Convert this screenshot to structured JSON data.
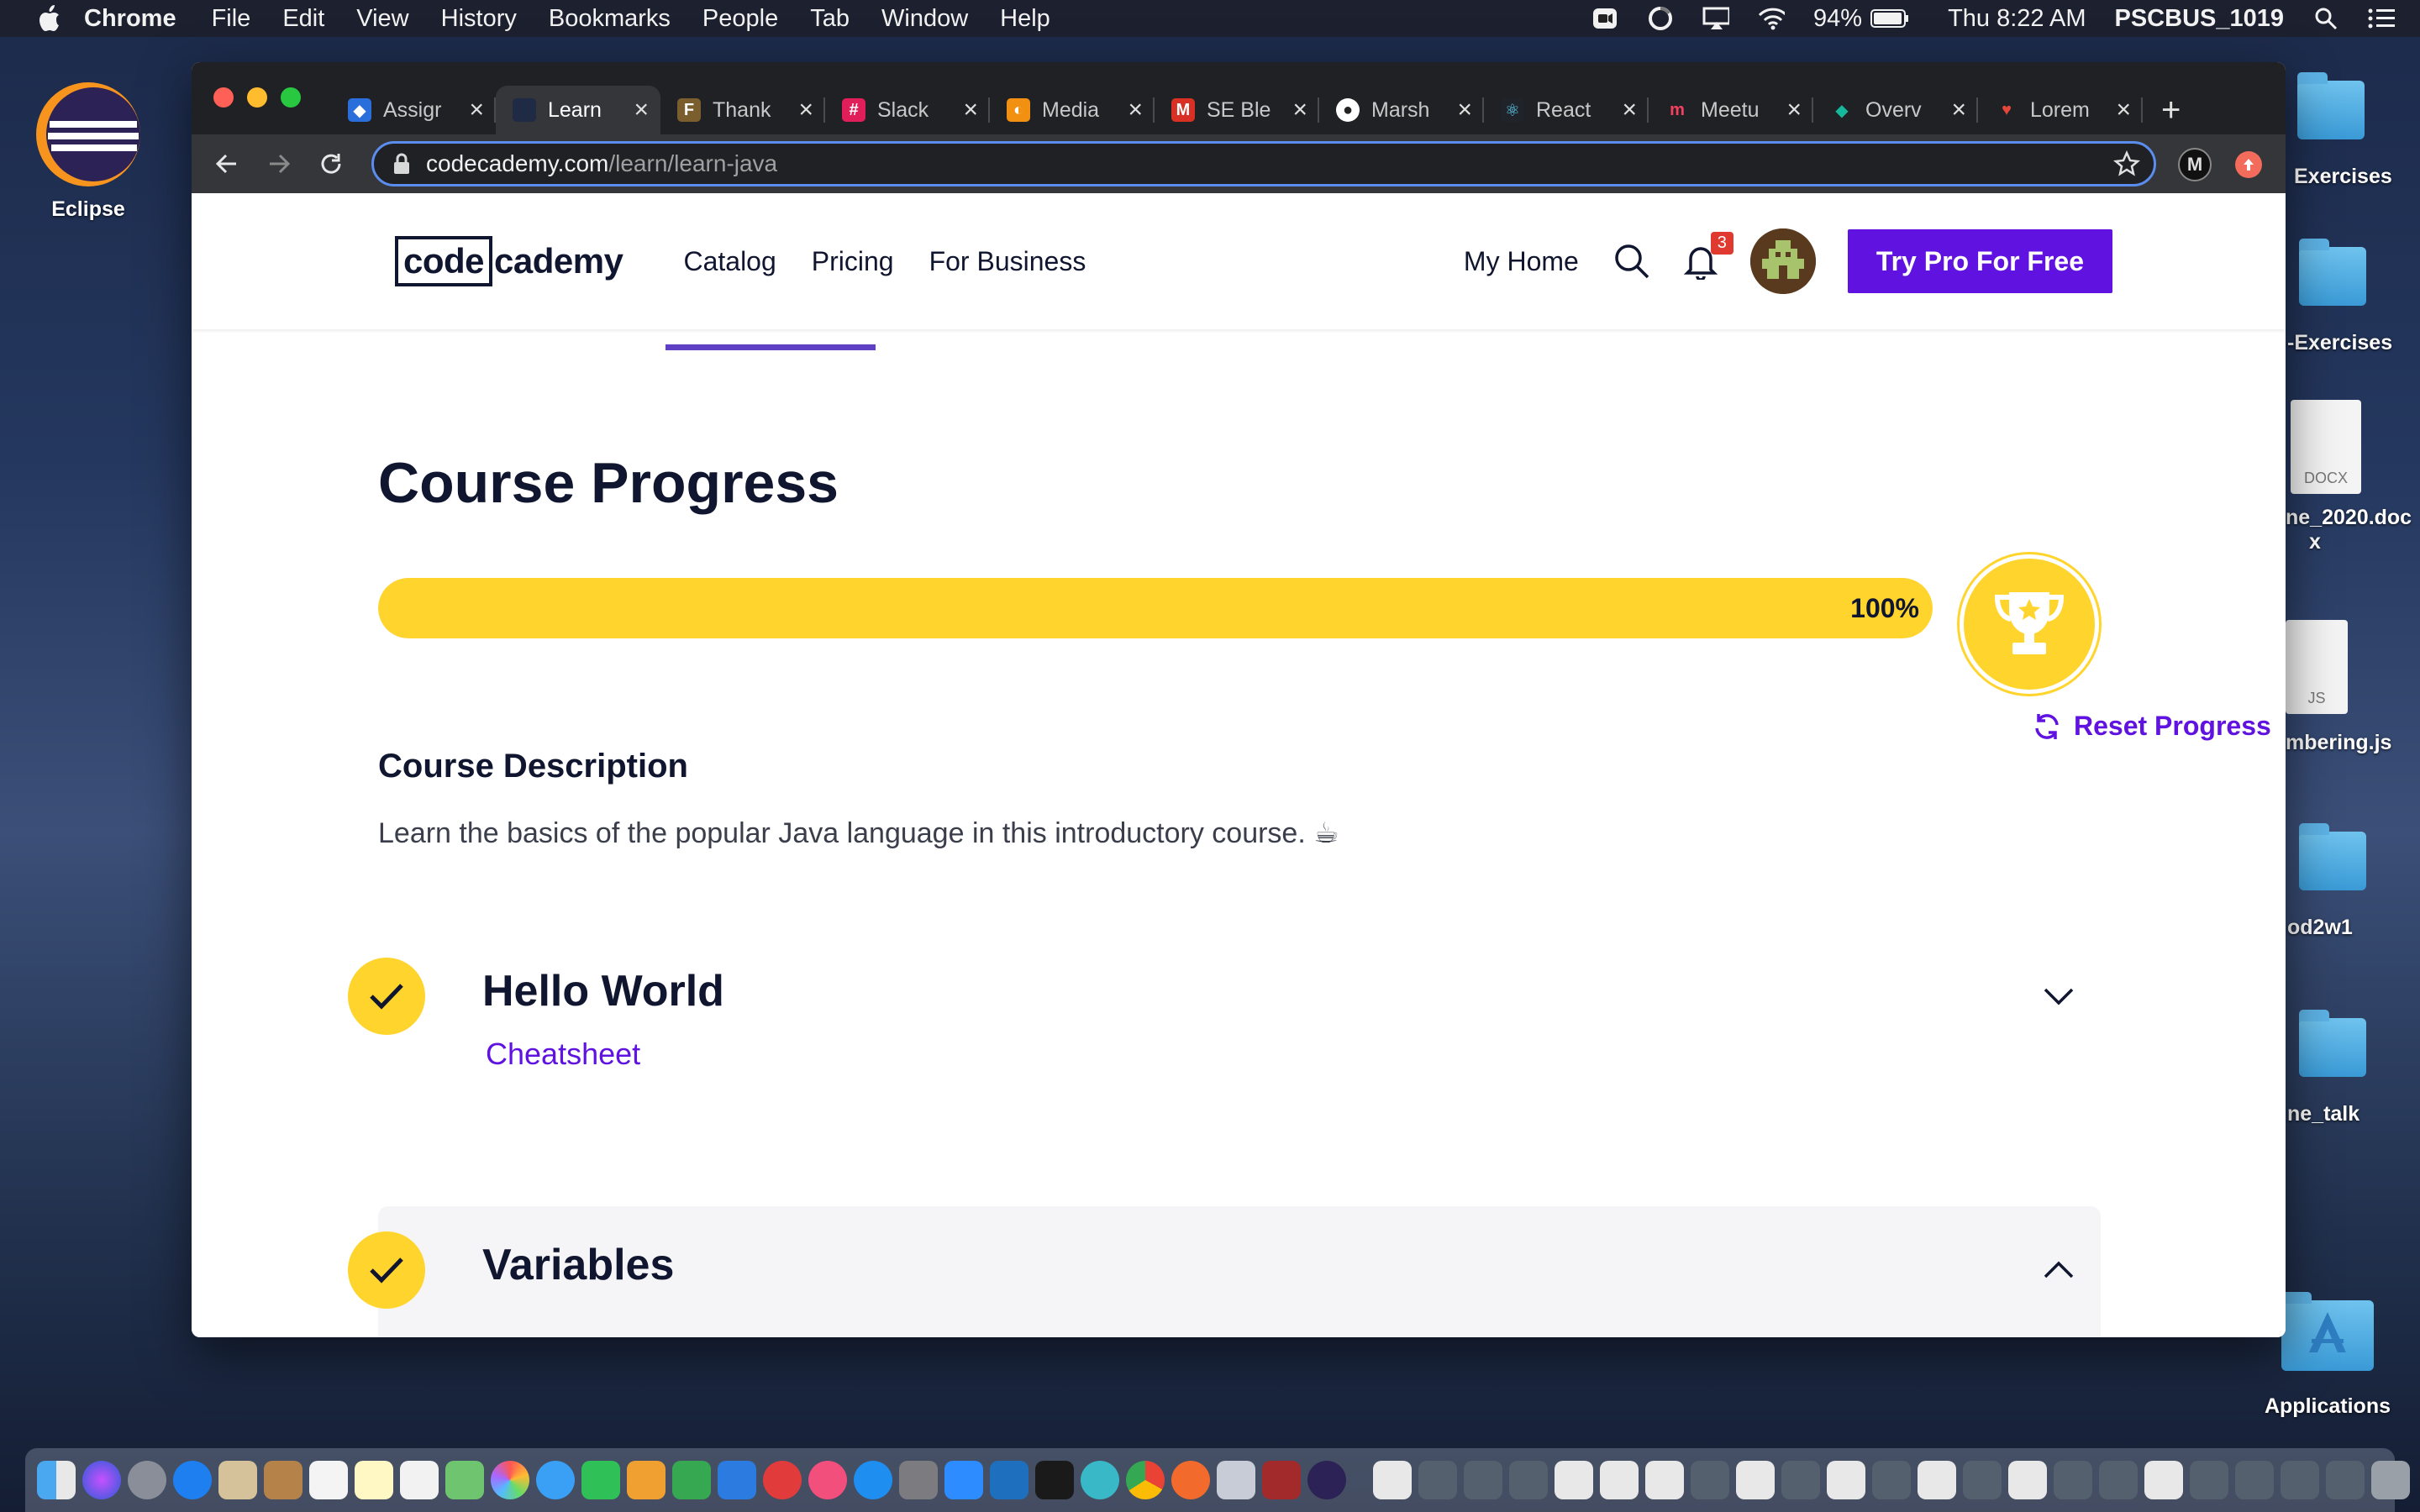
{
  "menubar": {
    "app_name": "Chrome",
    "menus": [
      "File",
      "Edit",
      "View",
      "History",
      "Bookmarks",
      "People",
      "Tab",
      "Window",
      "Help"
    ],
    "battery": "94%",
    "clock": "Thu 8:22 AM",
    "user": "PSCBUS_1019"
  },
  "desktop": {
    "left_icon_label": "Eclipse",
    "right_icons": [
      "Exercises",
      "-Exercises",
      "ne_2020.doc",
      "x",
      "mbering.js",
      "od2w1",
      "ne_talk",
      "Applications"
    ],
    "docx_badge": "DOCX",
    "js_badge": "JS"
  },
  "browser": {
    "tabs": [
      {
        "title": "Assigr",
        "active": false,
        "fav_color": "#2a6edb"
      },
      {
        "title": "Learn",
        "active": true,
        "fav_color": "#1f2a44"
      },
      {
        "title": "Thank",
        "active": false,
        "fav_color": "#7b5e2e"
      },
      {
        "title": "Slack",
        "active": false,
        "fav_color": "#e01e5a"
      },
      {
        "title": "Media",
        "active": false,
        "fav_color": "#f29111"
      },
      {
        "title": "SE Ble",
        "active": false,
        "fav_color": "#d93025"
      },
      {
        "title": "Marsh",
        "active": false,
        "fav_color": "#ffffff"
      },
      {
        "title": "React",
        "active": false,
        "fav_color": "#61dafb"
      },
      {
        "title": "Meetu",
        "active": false,
        "fav_color": "#f64060"
      },
      {
        "title": "Overv",
        "active": false,
        "fav_color": "#15b89a"
      },
      {
        "title": "Lorem",
        "active": false,
        "fav_color": "#e8453c"
      }
    ],
    "url_host": "codecademy.com",
    "url_path": "/learn/learn-java"
  },
  "site": {
    "logo_boxed": "code",
    "logo_rest": "cademy",
    "nav": [
      "Catalog",
      "Pricing",
      "For Business"
    ],
    "my_home": "My Home",
    "notification_count": "3",
    "cta": "Try Pro For Free"
  },
  "course": {
    "title": "Course Progress",
    "progress_percent": 100,
    "progress_label": "100%",
    "reset_label": "Reset Progress",
    "description_title": "Course Description",
    "description": "Learn the basics of the popular Java language in this introductory course. ☕",
    "modules": [
      {
        "title": "Hello World",
        "link": "Cheatsheet",
        "expanded": false
      },
      {
        "title": "Variables",
        "expanded": true
      }
    ]
  },
  "colors": {
    "brand_purple": "#5f12e0",
    "progress_yellow": "#ffd42c",
    "ink": "#10162f"
  }
}
